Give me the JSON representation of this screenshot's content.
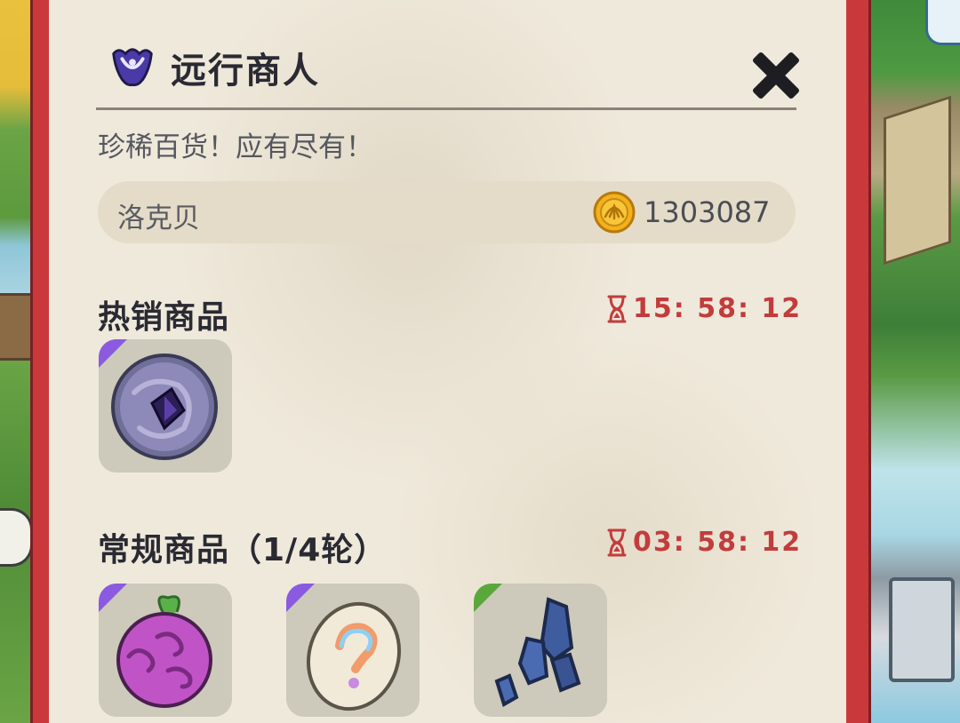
{
  "merchant": {
    "title": "远行商人",
    "subtitle": "珍稀百货！应有尽有！"
  },
  "player": {
    "name": "洛克贝",
    "coins": "1303087"
  },
  "hot_section": {
    "title": "热销商品",
    "timer": "15: 58: 12",
    "items": [
      {
        "icon": "dark-crystal-orb-icon",
        "rarity_color": "#8a5be0"
      }
    ]
  },
  "regular_section": {
    "title": "常规商品（1/4轮）",
    "timer": "03: 58: 12",
    "items": [
      {
        "icon": "purple-fruit-icon",
        "rarity_color": "#8a5be0"
      },
      {
        "icon": "rainbow-mystery-egg-icon",
        "rarity_color": "#8a5be0"
      },
      {
        "icon": "blue-crystal-cluster-icon",
        "rarity_color": "#5aa83a"
      }
    ]
  },
  "colors": {
    "frame_red": "#c9393b",
    "timer_red": "#c33c3c",
    "panel_bg": "#efe9db"
  }
}
